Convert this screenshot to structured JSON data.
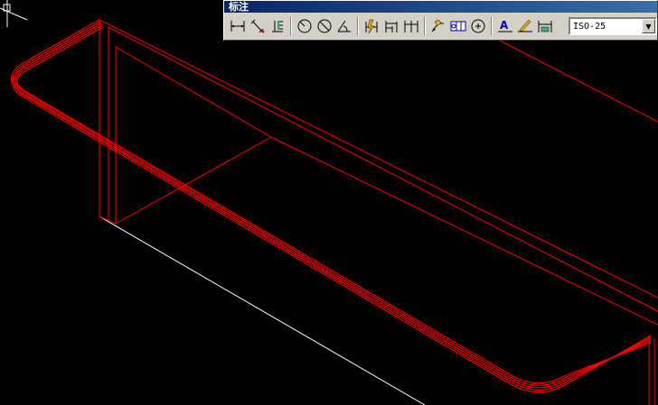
{
  "toolbar": {
    "title": "标注",
    "groups": [
      [
        "linear-dimension-icon",
        "aligned-dimension-icon",
        "ordinate-dimension-icon"
      ],
      [
        "radius-dimension-icon",
        "diameter-dimension-icon",
        "angular-dimension-icon"
      ],
      [
        "quick-dimension-icon",
        "baseline-dimension-icon",
        "continue-dimension-icon"
      ],
      [
        "quick-leader-icon",
        "tolerance-icon",
        "center-mark-icon"
      ],
      [
        "dimension-edit-icon",
        "dimension-text-edit-icon",
        "dimension-update-icon"
      ]
    ],
    "dim_style": {
      "value": "ISO-25",
      "arrow": "▼"
    }
  },
  "drawing": {
    "background": "#000000",
    "line_color": "#ff0000",
    "edge_color": "#ffffff"
  }
}
